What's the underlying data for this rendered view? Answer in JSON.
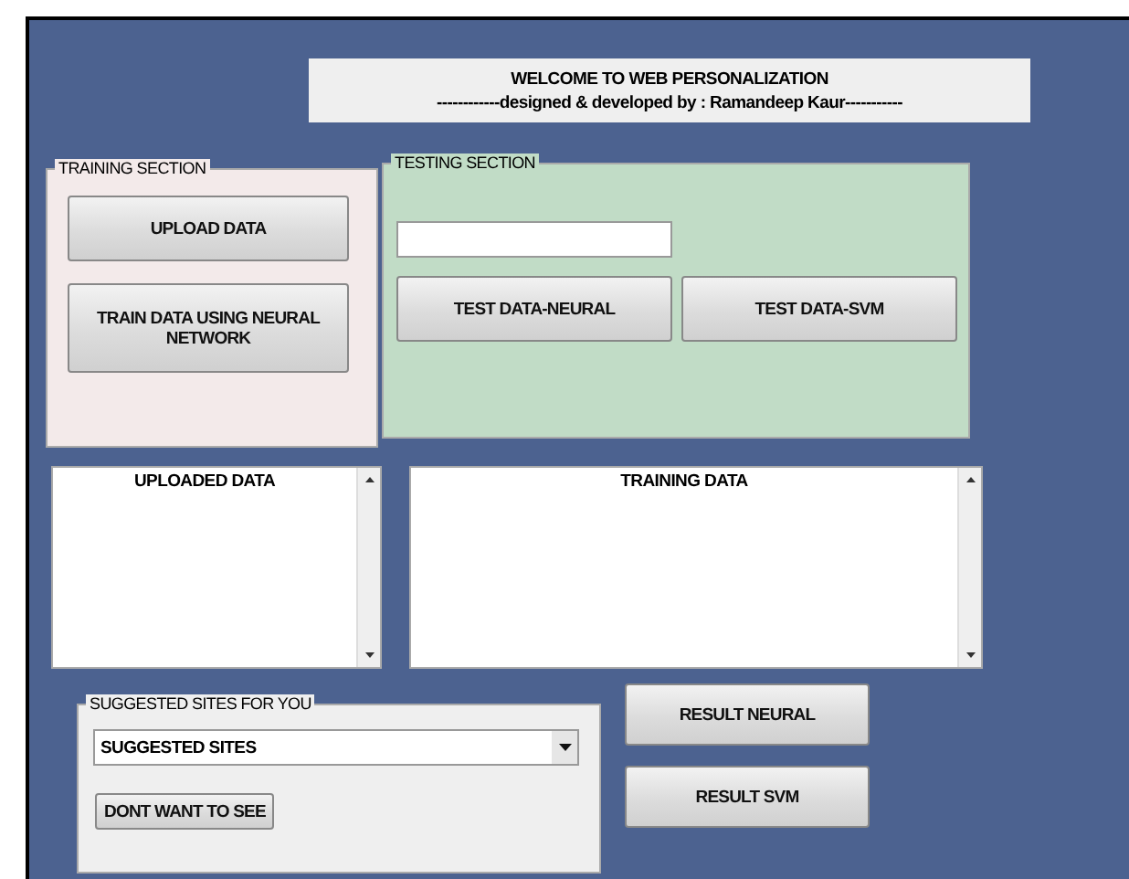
{
  "header": {
    "title": "WELCOME TO WEB PERSONALIZATION",
    "subtitle": "------------designed & developed by : Ramandeep Kaur-----------"
  },
  "training_section": {
    "label": "TRAINING SECTION",
    "buttons": [
      "UPLOAD DATA",
      "TRAIN DATA USING NEURAL NETWORK"
    ]
  },
  "testing_section": {
    "label": "TESTING SECTION",
    "buttons": [
      "TEST DATA-NEURAL",
      "TEST DATA-SVM"
    ]
  },
  "lists": [
    {
      "header": "UPLOADED DATA"
    },
    {
      "header": "TRAINING DATA"
    }
  ],
  "suggested_panel": {
    "label": "SUGGESTED SITES FOR YOU",
    "dropdown": "SUGGESTED SITES",
    "button": "DONT WANT TO SEE"
  },
  "result_buttons": [
    "RESULT NEURAL",
    "RESULT SVM"
  ]
}
